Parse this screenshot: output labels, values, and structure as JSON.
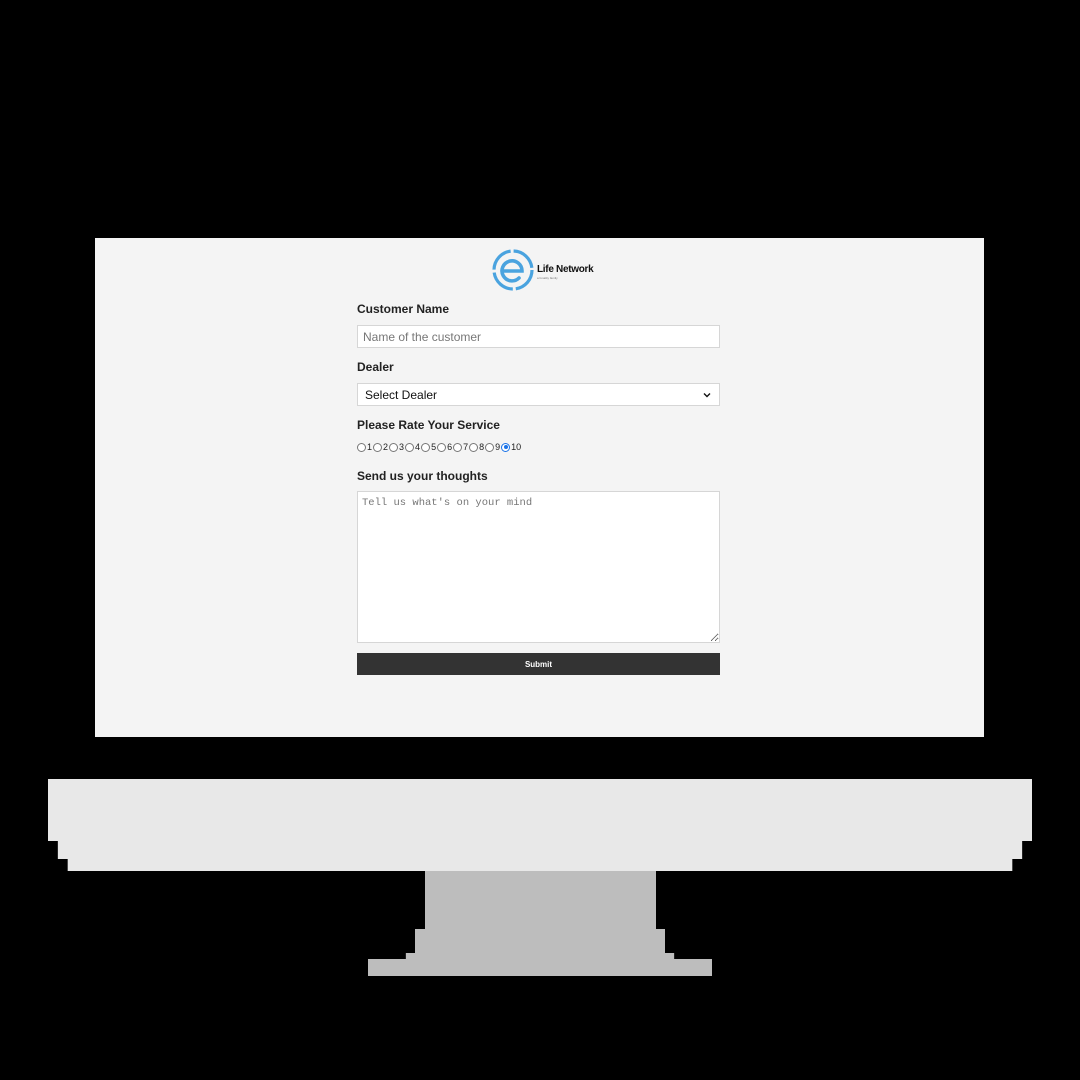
{
  "brand": {
    "name": "Life Network",
    "tagline": "a fonality family",
    "logo_color": "#4aa3df"
  },
  "form": {
    "customer_name": {
      "label": "Customer Name",
      "placeholder": "Name of the customer"
    },
    "dealer": {
      "label": "Dealer",
      "selected": "Select Dealer"
    },
    "rating": {
      "label": "Please Rate Your Service",
      "options": [
        "1",
        "2",
        "3",
        "4",
        "5",
        "6",
        "7",
        "8",
        "9",
        "10"
      ],
      "selected": "10"
    },
    "thoughts": {
      "label": "Send us your thoughts",
      "placeholder": "Tell us what's on your mind"
    },
    "submit_label": "Submit"
  }
}
